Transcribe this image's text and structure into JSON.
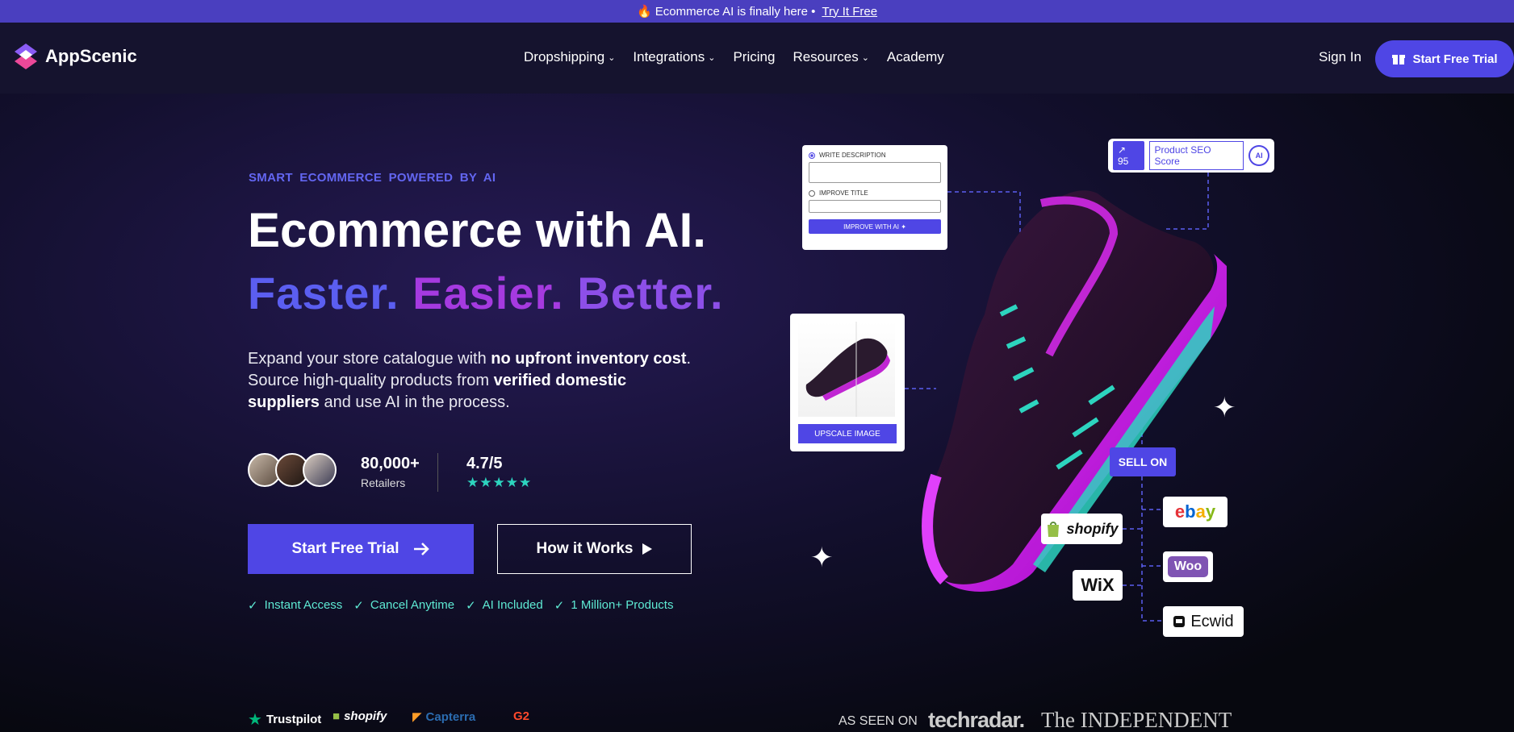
{
  "announcement": {
    "icon": "fire-icon",
    "text": "🔥 Ecommerce AI is finally here •",
    "link": "Try It Free"
  },
  "nav": {
    "logo": "AppScenic",
    "items": [
      "Dropshipping",
      "Integrations",
      "Pricing",
      "Resources",
      "Academy"
    ],
    "sign_in": "Sign In",
    "trial": "Start Free Trial"
  },
  "hero": {
    "eyebrow": "SMART  ECOMMERCE  POWERED BY AI",
    "headline": "Ecommerce with AI.",
    "taglines": [
      "Faster.",
      "Easier.",
      "Better."
    ],
    "desc_parts": [
      "Expand your store catalogue with ",
      "no upfront inventory cost",
      ". Source high-quality products from ",
      "verified domestic suppliers",
      " and use AI in the process."
    ],
    "retailers_count": "80,000+",
    "retailers_label": "Retailers",
    "rating": "4.7/5",
    "stars": "★★★★★",
    "primary_cta": "Start Free Trial",
    "secondary_cta": "How it Works",
    "checks": [
      "Instant Access",
      "Cancel Anytime",
      "AI Included",
      "1 Million+ Products"
    ]
  },
  "cards": {
    "write_description": "WRITE DESCRIPTION",
    "improve_title": "IMPROVE TITLE",
    "improve_button": "IMPROVE WITH AI ✦",
    "seo_score": "95",
    "seo_label": "Product SEO Score",
    "seo_ai": "AI",
    "upscale": "UPSCALE IMAGE",
    "sell_on": "SELL ON"
  },
  "platforms": {
    "shopify": "shopify",
    "ebay": "ebay",
    "woo": "Woo",
    "wix": "WiX",
    "ecwid": "Ecwid"
  },
  "bottom": {
    "reviews": [
      "Trustpilot",
      "shopify",
      "Capterra",
      "G2"
    ],
    "as_seen_on": "AS SEEN ON",
    "press": [
      "techradar.",
      "The INDEPENDENT"
    ]
  },
  "colors": {
    "accent": "#4f46e5",
    "teal": "#2dd4bf",
    "magenta": "#c026d3"
  }
}
